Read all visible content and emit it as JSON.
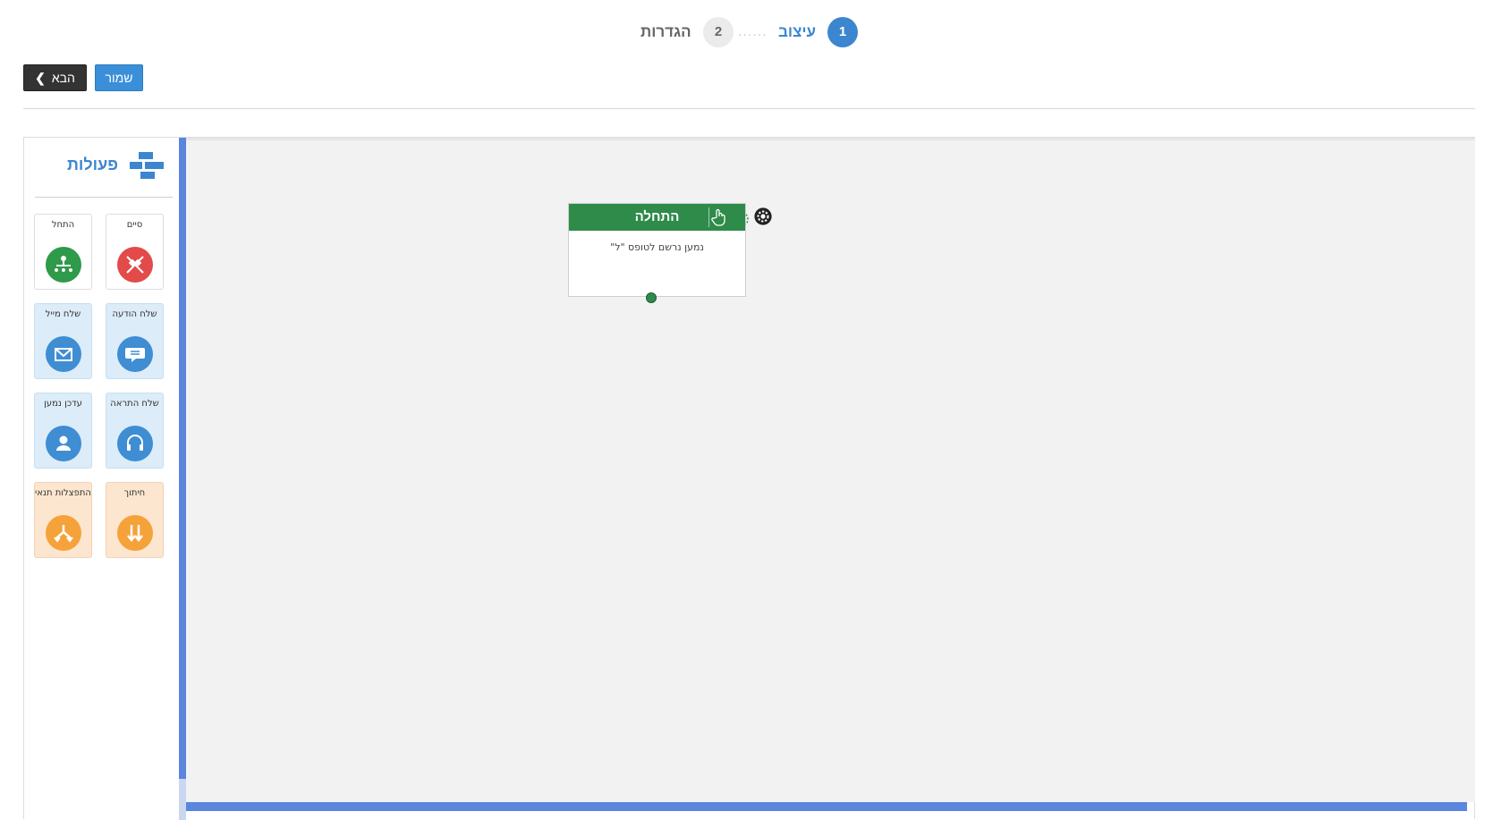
{
  "stepper": {
    "step1": {
      "number": "1",
      "label": "עיצוב",
      "active": true
    },
    "step2": {
      "number": "2",
      "label": "הגדרות",
      "active": false
    },
    "separator": "......"
  },
  "toolbar": {
    "next_label": "הבא",
    "save_label": "שמור"
  },
  "sidebar": {
    "title": "פעולות",
    "title_icon": "blocks-icon",
    "tiles": [
      {
        "label": "סיים",
        "icon": "finish-flags-icon",
        "color": "#e34a4a",
        "style": "white"
      },
      {
        "label": "התחל",
        "icon": "start-tree-icon",
        "color": "#2e9a4a",
        "style": "white"
      },
      {
        "label": "שלח הודעה",
        "icon": "chat-bubble-icon",
        "color": "#3f8dd3",
        "style": "blue"
      },
      {
        "label": "שלח מייל",
        "icon": "envelope-icon",
        "color": "#3f8dd3",
        "style": "blue"
      },
      {
        "label": "שלח התראה",
        "icon": "headset-icon",
        "color": "#3f8dd3",
        "style": "blue"
      },
      {
        "label": "עדכן נמען",
        "icon": "user-icon",
        "color": "#3f8dd3",
        "style": "blue"
      },
      {
        "label": "חיתוך",
        "icon": "split-arrows-icon",
        "color": "#f5a23a",
        "style": "orange"
      },
      {
        "label": "התפצלות תנאי",
        "icon": "branch-icon",
        "color": "#f5a23a",
        "style": "orange"
      }
    ]
  },
  "canvas": {
    "node": {
      "title": "התחלה",
      "body": "נמען נרשם לטופס \"ל\"",
      "color": "#2e8b4a"
    }
  },
  "colors": {
    "accent": "#3b86cf",
    "canvas_bar": "#5b86dd"
  }
}
